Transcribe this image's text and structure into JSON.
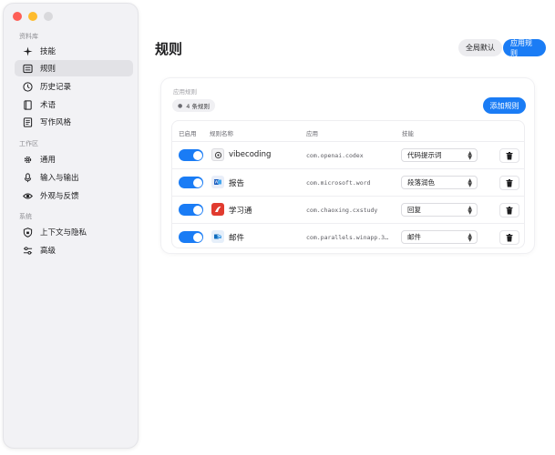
{
  "sidebar": {
    "sections": [
      {
        "label": "资料库",
        "items": [
          {
            "label": "技能",
            "icon": "sparkle-icon"
          },
          {
            "label": "规则",
            "icon": "list-icon",
            "active": true
          },
          {
            "label": "历史记录",
            "icon": "clock-icon"
          },
          {
            "label": "术语",
            "icon": "book-icon"
          },
          {
            "label": "写作风格",
            "icon": "document-icon"
          }
        ]
      },
      {
        "label": "工作区",
        "items": [
          {
            "label": "通用",
            "icon": "gear-icon"
          },
          {
            "label": "输入与输出",
            "icon": "microphone-icon"
          },
          {
            "label": "外观与反馈",
            "icon": "eye-icon"
          }
        ]
      },
      {
        "label": "系统",
        "items": [
          {
            "label": "上下文与隐私",
            "icon": "shield-icon"
          },
          {
            "label": "高级",
            "icon": "sliders-icon"
          }
        ]
      }
    ]
  },
  "main": {
    "title": "规则",
    "segment": {
      "global_label": "全局默认",
      "app_label": "应用规则",
      "selected": "app"
    },
    "card": {
      "title": "应用规则",
      "count_label": "4 条规则",
      "add_label": "添加规则"
    },
    "table": {
      "headers": [
        "已启用",
        "规则名称",
        "应用",
        "技能"
      ],
      "rows": [
        {
          "enabled": true,
          "name": "vibecoding",
          "app": "com.openai.codex",
          "skill": "代码提示词",
          "icon": "codex-icon"
        },
        {
          "enabled": true,
          "name": "报告",
          "app": "com.microsoft.word",
          "skill": "段落润色",
          "icon": "word-icon"
        },
        {
          "enabled": true,
          "name": "学习通",
          "app": "com.chaoxing.cxstudy",
          "skill": "回复",
          "icon": "study-icon"
        },
        {
          "enabled": true,
          "name": "邮件",
          "app": "com.parallels.winapp.3…",
          "skill": "邮件",
          "icon": "mail-icon"
        }
      ]
    }
  },
  "colors": {
    "accent": "#1a7cf5",
    "sidebar_bg": "#f2f2f5"
  }
}
